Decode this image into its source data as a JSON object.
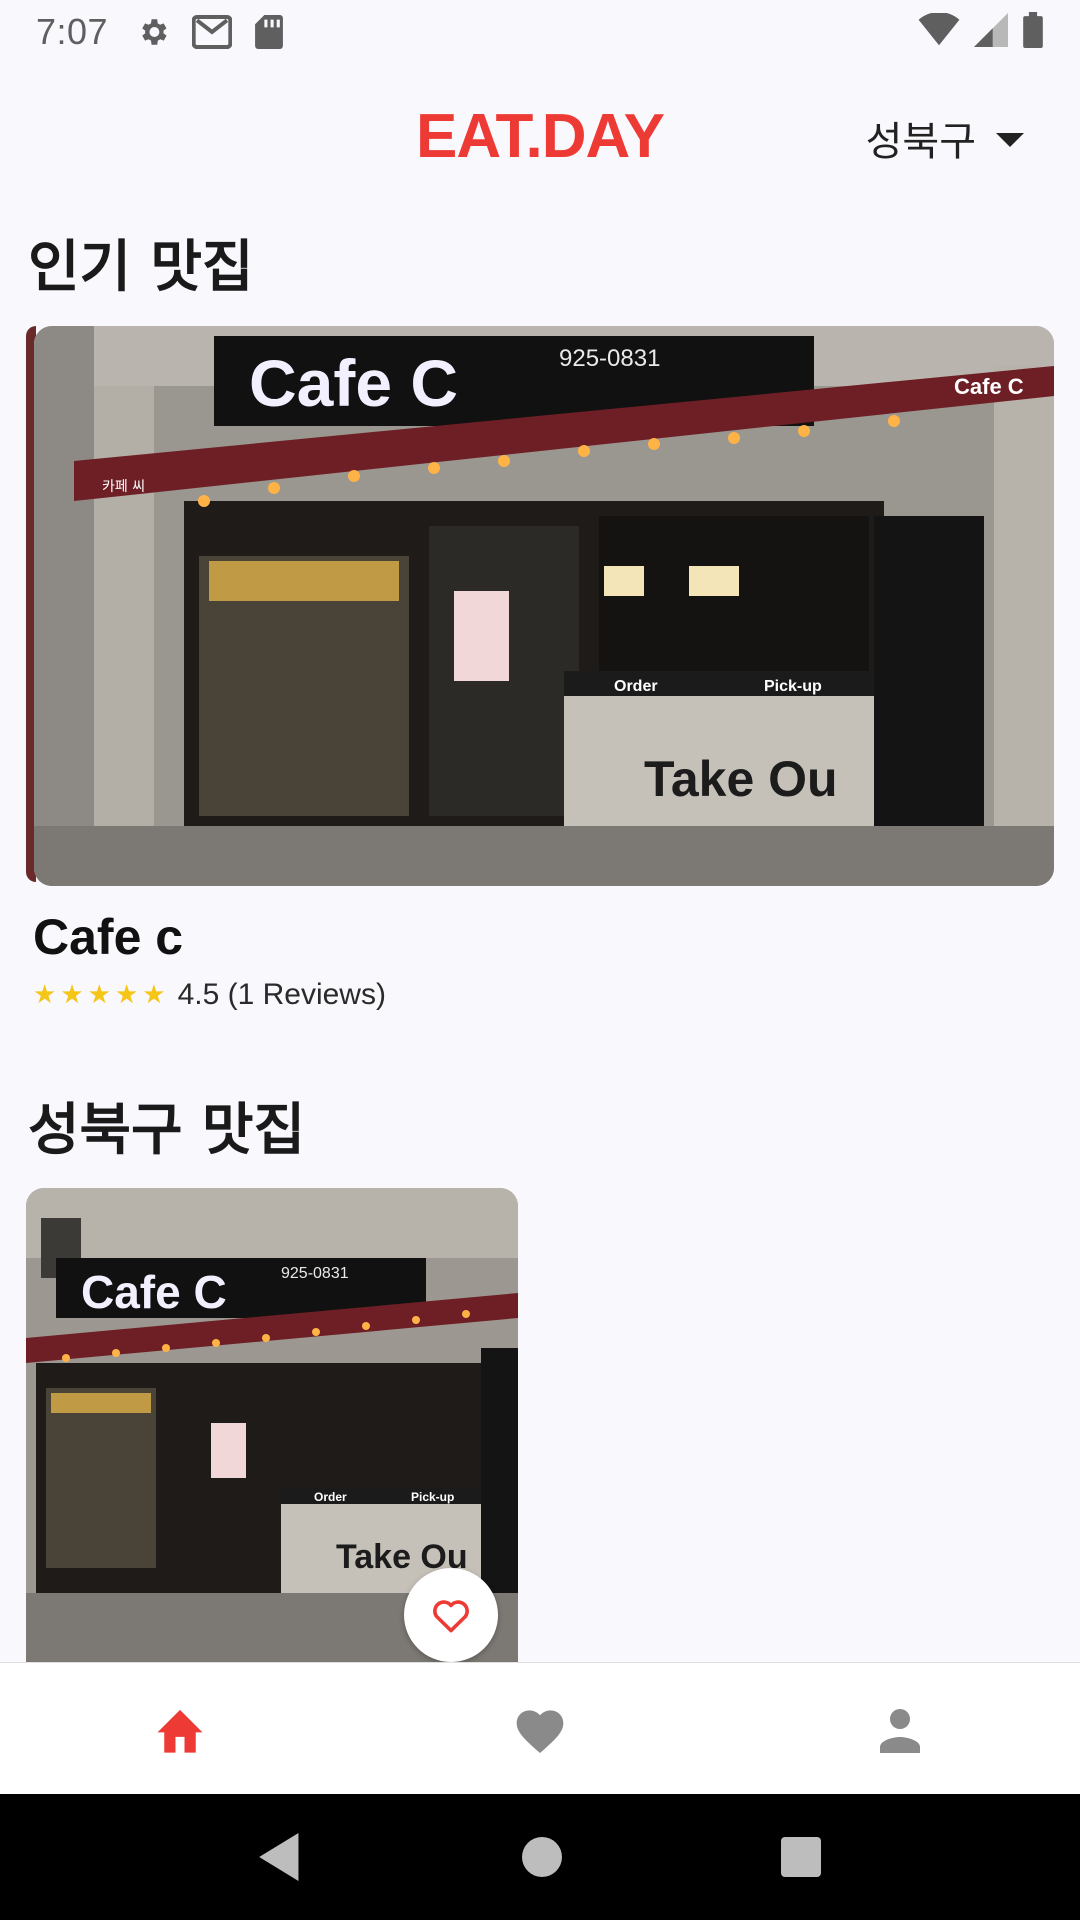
{
  "status_bar": {
    "time": "7:07",
    "left_icons": [
      "gear-icon",
      "gmail-icon",
      "sd-card-icon"
    ],
    "right_icons": [
      "wifi-icon",
      "cell-signal-icon",
      "battery-icon"
    ]
  },
  "app_bar": {
    "title": "EAT.DAY",
    "region": "성북구",
    "accent": "#ee3a34"
  },
  "popular": {
    "section_title": "인기 맛집",
    "restaurant": {
      "name": "Cafe c",
      "rating_stars": 5,
      "rating_text": "4.5 (1 Reviews)",
      "sign_text": "Cafe C",
      "phone_sign": "925-0831",
      "small_sign": "카페 씨",
      "window_labels": [
        "Order",
        "Pick-up"
      ],
      "wall_text": "Take Ou"
    }
  },
  "local": {
    "section_title": "성북구 맛집",
    "restaurant": {
      "sign_text": "Cafe C",
      "phone_sign": "925-0831",
      "window_labels": [
        "Order",
        "Pick-up"
      ],
      "wall_text": "Take Ou"
    }
  },
  "bottom_nav": {
    "items": [
      {
        "icon": "home-icon",
        "active": true
      },
      {
        "icon": "heart-icon",
        "active": false
      },
      {
        "icon": "person-icon",
        "active": false
      }
    ],
    "active_color": "#ee3a34",
    "inactive_color": "#8a8a8a"
  },
  "system_nav": [
    "back-icon",
    "home-circle-icon",
    "recents-icon"
  ]
}
